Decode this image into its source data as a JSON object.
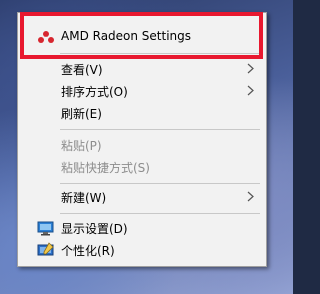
{
  "context_menu": {
    "items": [
      {
        "label": "AMD Radeon Settings",
        "icon": "amd-radeon-icon",
        "submenu": false,
        "enabled": true
      },
      {
        "label": "查看(V)",
        "submenu": true,
        "enabled": true
      },
      {
        "label": "排序方式(O)",
        "submenu": true,
        "enabled": true
      },
      {
        "label": "刷新(E)",
        "submenu": false,
        "enabled": true
      },
      {
        "label": "粘贴(P)",
        "submenu": false,
        "enabled": false
      },
      {
        "label": "粘贴快捷方式(S)",
        "submenu": false,
        "enabled": false
      },
      {
        "label": "新建(W)",
        "submenu": true,
        "enabled": true
      },
      {
        "label": "显示设置(D)",
        "icon": "display-icon",
        "submenu": false,
        "enabled": true
      },
      {
        "label": "个性化(R)",
        "icon": "personalize-icon",
        "submenu": false,
        "enabled": true
      }
    ]
  },
  "colors": {
    "highlight_border": "#e8182f",
    "menu_background": "#f2f2f2",
    "amd_red": "#d7262f",
    "disabled_text": "#8d8d8d"
  }
}
